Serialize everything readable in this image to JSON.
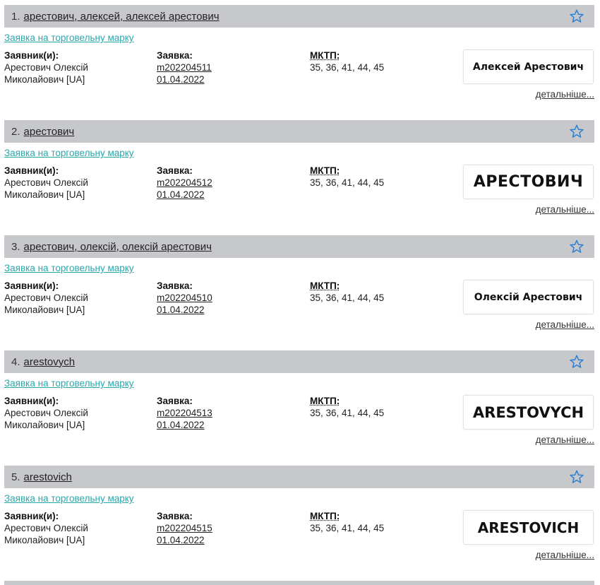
{
  "results": [
    {
      "number": "1.",
      "title": "арестович, алексей, алексей арестович",
      "type_link": "Заявка на торговельну марку",
      "applicant_label": "Заявник(и):",
      "applicant_line1": "Арестович Олексій",
      "applicant_line2": "Миколайович [UA]",
      "application_label": "Заявка:",
      "application_number": "m202204511",
      "application_date": "01.04.2022",
      "mktp_label": "МКТП:",
      "mktp_value": "35, 36, 41, 44, 45",
      "mark_text": "Алексей Арестович",
      "details": "детальніше..."
    },
    {
      "number": "2.",
      "title": "арестович",
      "type_link": "Заявка на торговельну марку",
      "applicant_label": "Заявник(и):",
      "applicant_line1": "Арестович Олексій",
      "applicant_line2": "Миколайович [UA]",
      "application_label": "Заявка:",
      "application_number": "m202204512",
      "application_date": "01.04.2022",
      "mktp_label": "МКТП:",
      "mktp_value": "35, 36, 41, 44, 45",
      "mark_text": "АРЕСТОВИЧ",
      "details": "детальніше..."
    },
    {
      "number": "3.",
      "title": "арестович, олексій, олексій арестович",
      "type_link": "Заявка на торговельну марку",
      "applicant_label": "Заявник(и):",
      "applicant_line1": "Арестович Олексій",
      "applicant_line2": "Миколайович [UA]",
      "application_label": "Заявка:",
      "application_number": "m202204510",
      "application_date": "01.04.2022",
      "mktp_label": "МКТП:",
      "mktp_value": "35, 36, 41, 44, 45",
      "mark_text": "Олексій Арестович",
      "details": "детальніше..."
    },
    {
      "number": "4.",
      "title": "arestovych",
      "type_link": "Заявка на торговельну марку",
      "applicant_label": "Заявник(и):",
      "applicant_line1": "Арестович Олексій",
      "applicant_line2": "Миколайович [UA]",
      "application_label": "Заявка:",
      "application_number": "m202204513",
      "application_date": "01.04.2022",
      "mktp_label": "МКТП:",
      "mktp_value": "35, 36, 41, 44, 45",
      "mark_text": "ARESTOVYCH",
      "details": "детальніше..."
    },
    {
      "number": "5.",
      "title": "arestovich",
      "type_link": "Заявка на торговельну марку",
      "applicant_label": "Заявник(и):",
      "applicant_line1": "Арестович Олексій",
      "applicant_line2": "Миколайович [UA]",
      "application_label": "Заявка:",
      "application_number": "m202204515",
      "application_date": "01.04.2022",
      "mktp_label": "МКТП:",
      "mktp_value": "35, 36, 41, 44, 45",
      "mark_text": "ARESTOVICH",
      "details": "детальніше..."
    }
  ],
  "colors": {
    "header_bg": "#c7c8cb",
    "link": "#2aa7ab",
    "star": "#2a7fd4"
  },
  "icons": {
    "favorite": "star-outline-icon"
  }
}
